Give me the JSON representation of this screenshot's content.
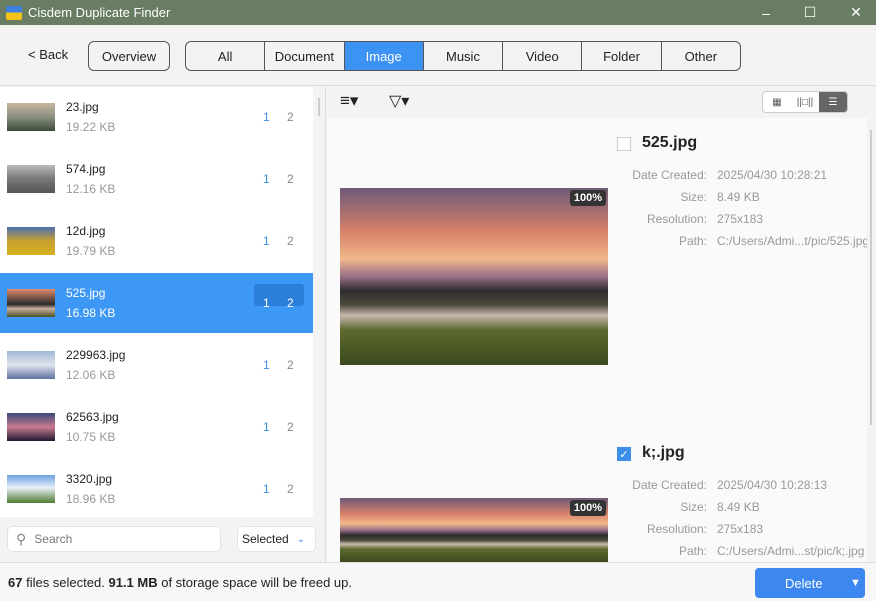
{
  "app": {
    "title": "Cisdem Duplicate Finder"
  },
  "toolbar": {
    "back": "< Back",
    "overview": "Overview",
    "tabs": [
      "All",
      "Document",
      "Image",
      "Music",
      "Video",
      "Folder",
      "Other"
    ]
  },
  "list": [
    {
      "name": "23.jpg",
      "size": "19.22 KB",
      "a": "1",
      "b": "2"
    },
    {
      "name": "574.jpg",
      "size": "12.16 KB",
      "a": "1",
      "b": "2"
    },
    {
      "name": "12d.jpg",
      "size": "19.79 KB",
      "a": "1",
      "b": "2"
    },
    {
      "name": "525.jpg",
      "size": "16.98 KB",
      "a": "1",
      "b": "2"
    },
    {
      "name": "229963.jpg",
      "size": "12.06 KB",
      "a": "1",
      "b": "2"
    },
    {
      "name": "62563.jpg",
      "size": "10.75 KB",
      "a": "1",
      "b": "2"
    },
    {
      "name": "3320.jpg",
      "size": "18.96 KB",
      "a": "1",
      "b": "2"
    }
  ],
  "search": {
    "placeholder": "Search"
  },
  "filter": {
    "selected": "Selected"
  },
  "details": [
    {
      "name": "525.jpg",
      "checked": false,
      "zoom": "100%",
      "date": "2025/04/30 10:28:21",
      "size": "8.49 KB",
      "resolution": "275x183",
      "path": "C:/Users/Admi...t/pic/525.jpg"
    },
    {
      "name": "k;.jpg",
      "checked": true,
      "zoom": "100%",
      "date": "2025/04/30 10:28:13",
      "size": "8.49 KB",
      "resolution": "275x183",
      "path": "C:/Users/Admi...st/pic/k;.jpg"
    }
  ],
  "labels": {
    "date": "Date Created:",
    "size": "Size:",
    "resolution": "Resolution:",
    "path": "Path:"
  },
  "footer": {
    "count": "67",
    "mid": " files selected. ",
    "size": "91.1 MB",
    "tail": " of storage space will be freed up.",
    "delete": "Delete"
  }
}
